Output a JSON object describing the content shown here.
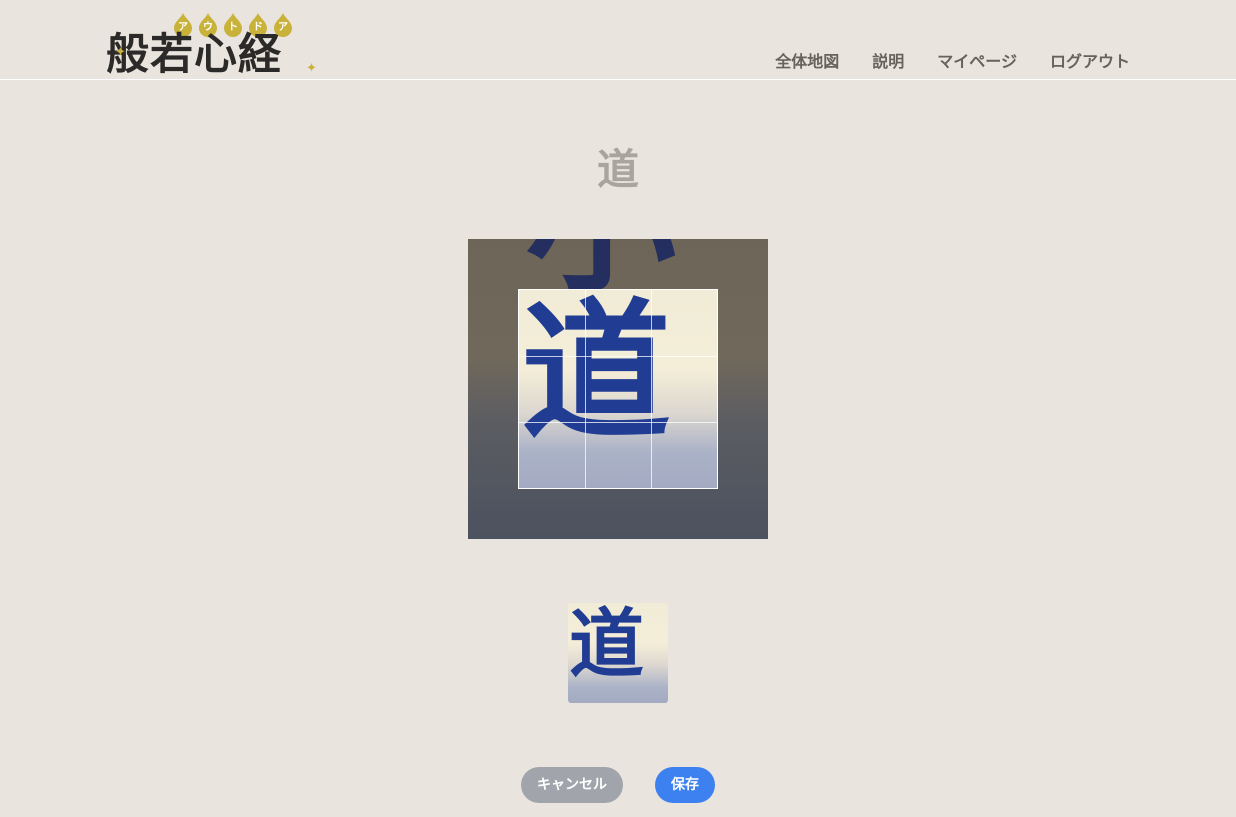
{
  "header": {
    "logo": {
      "title": "般若心経",
      "subtitle_letters": [
        "ア",
        "ウ",
        "ト",
        "ド",
        "ア"
      ],
      "accent_color": "#c9b23a"
    },
    "nav": [
      {
        "label": "全体地図"
      },
      {
        "label": "説明"
      },
      {
        "label": "マイページ"
      },
      {
        "label": "ログアウト"
      }
    ]
  },
  "main": {
    "character": "道",
    "crop_image": {
      "main_char": "道",
      "top_char": "小",
      "grid": "3x3"
    },
    "preview": {
      "char": "道"
    }
  },
  "buttons": {
    "cancel_label": "キャンセル",
    "save_label": "保存",
    "cancel_color": "#a1a4ab",
    "save_color": "#3d80f0"
  }
}
